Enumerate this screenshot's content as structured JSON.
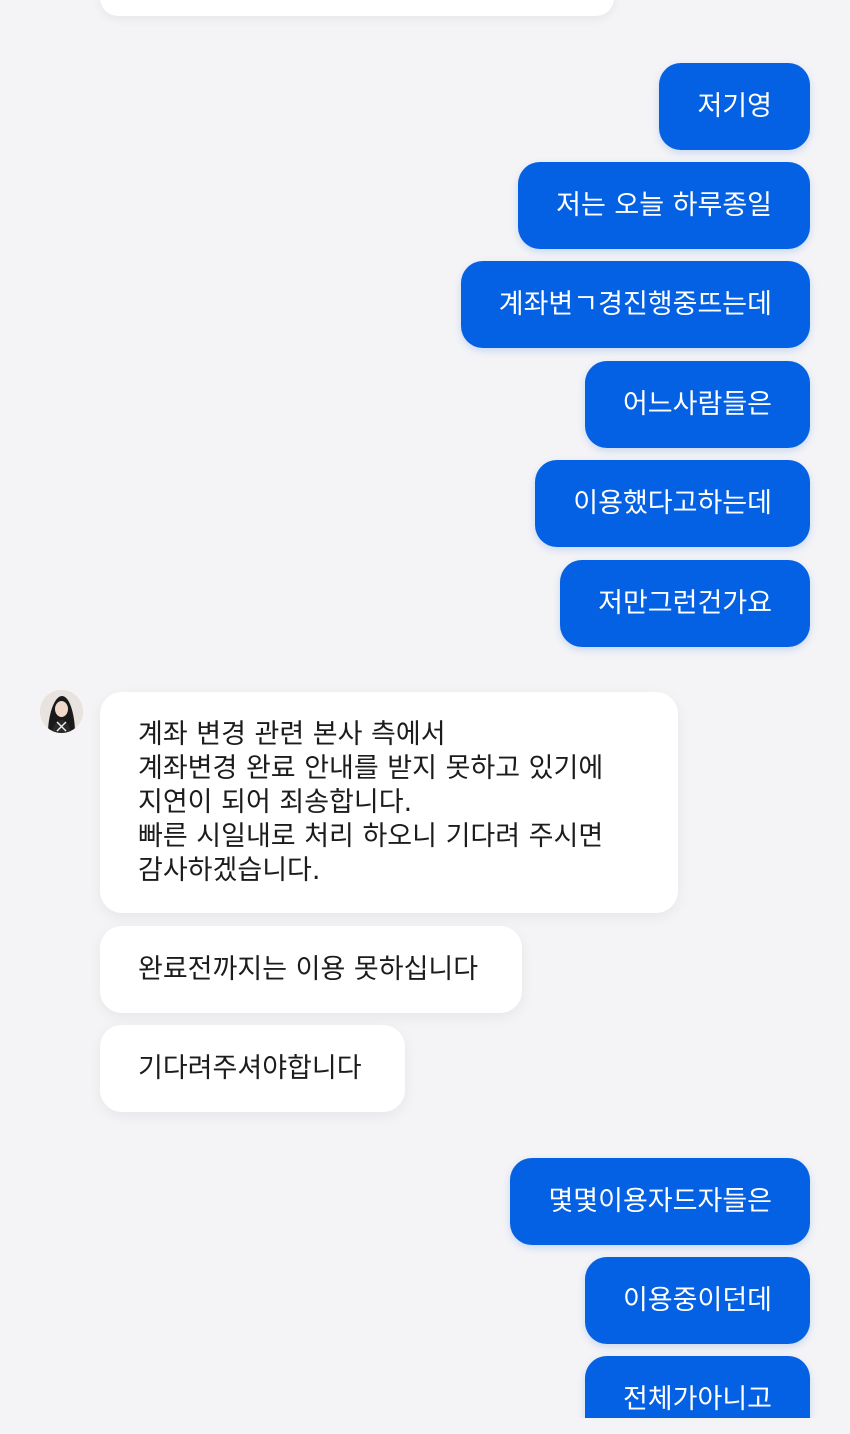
{
  "conversation": {
    "outgoing_group_1": [
      "저기영",
      "저는 오늘 하루종일",
      "계좌변ㄱ경진행중뜨는데",
      "어느사람들은",
      "이용했다고하는데",
      "저만그런건가요"
    ],
    "incoming": {
      "avatar_icon": "user-avatar-icon",
      "message_1_lines": [
        "계좌 변경 관련 본사 측에서",
        "계좌변경 완료 안내를 받지 못하고 있기에",
        "지연이 되어 죄송합니다.",
        "빠른 시일내로 처리 하오니 기다려 주시면",
        "감사하겠습니다."
      ],
      "message_2": "완료전까지는 이용 못하십니다",
      "message_3": "기다려주셔야합니다"
    },
    "outgoing_group_2": [
      "몇몇이용자드자들은",
      "이용중이던데",
      "전체가아니고"
    ]
  },
  "colors": {
    "background": "#f4f4f6",
    "outgoing_bubble": "#0561e3",
    "incoming_bubble": "#ffffff",
    "incoming_text": "#1c1c1c"
  }
}
